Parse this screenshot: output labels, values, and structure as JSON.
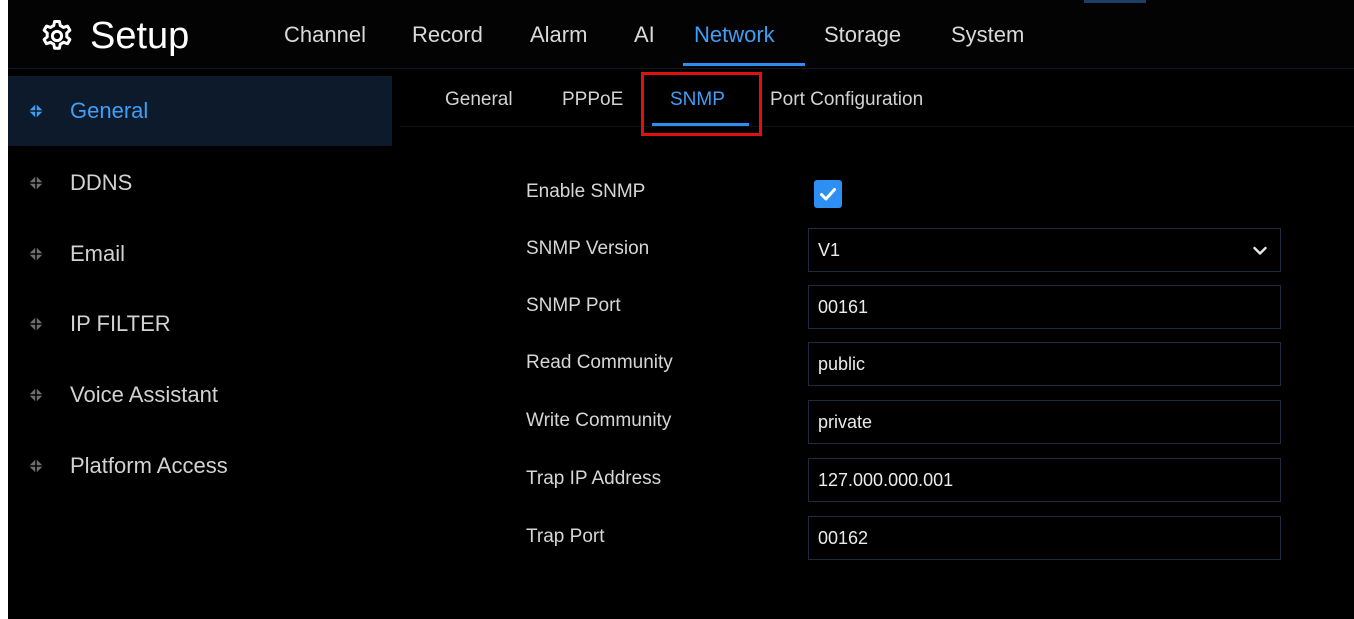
{
  "header": {
    "title": "Setup",
    "settings_icon": "gear-icon"
  },
  "main_tabs": [
    {
      "label": "Channel",
      "active": false
    },
    {
      "label": "Record",
      "active": false
    },
    {
      "label": "Alarm",
      "active": false
    },
    {
      "label": "AI",
      "active": false
    },
    {
      "label": "Network",
      "active": true
    },
    {
      "label": "Storage",
      "active": false
    },
    {
      "label": "System",
      "active": false
    }
  ],
  "sidebar": {
    "items": [
      {
        "label": "General",
        "active": true,
        "icon": "diamond-icon"
      },
      {
        "label": "DDNS",
        "active": false,
        "icon": "diamond-icon"
      },
      {
        "label": "Email",
        "active": false,
        "icon": "diamond-icon"
      },
      {
        "label": "IP FILTER",
        "active": false,
        "icon": "diamond-icon"
      },
      {
        "label": "Voice Assistant",
        "active": false,
        "icon": "diamond-icon"
      },
      {
        "label": "Platform Access",
        "active": false,
        "icon": "diamond-icon"
      }
    ]
  },
  "sub_tabs": [
    {
      "label": "General",
      "active": false
    },
    {
      "label": "PPPoE",
      "active": false
    },
    {
      "label": "SNMP",
      "active": true
    },
    {
      "label": "Port Configuration",
      "active": false
    }
  ],
  "form": {
    "enable_snmp": {
      "label": "Enable SNMP",
      "checked": true
    },
    "snmp_version": {
      "label": "SNMP Version",
      "value": "V1"
    },
    "snmp_port": {
      "label": "SNMP Port",
      "value": "00161"
    },
    "read_community": {
      "label": "Read Community",
      "value": "public"
    },
    "write_community": {
      "label": "Write Community",
      "value": "private"
    },
    "trap_ip_address": {
      "label": "Trap IP Address",
      "value": "127.000.000.001"
    },
    "trap_port": {
      "label": "Trap Port",
      "value": "00162"
    }
  },
  "colors": {
    "accent": "#3f9ef5",
    "background": "#000000",
    "highlight_box": "#e01010",
    "sidebar_active_bg": "#0d1a2b"
  }
}
